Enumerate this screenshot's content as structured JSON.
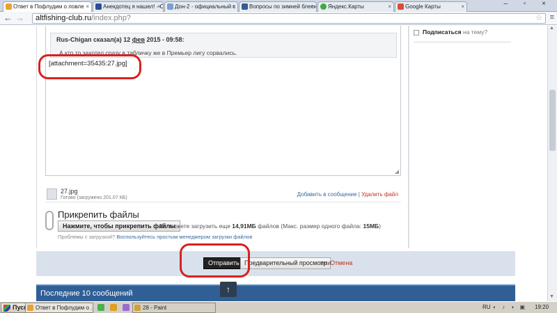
{
  "browser": {
    "tabs": [
      {
        "title": "Ответ в Пофлудим о ловле",
        "color": "#e8a232",
        "active": true
      },
      {
        "title": "Анекдотец я нашел! - Стр",
        "color": "#2b4c9b",
        "active": false
      },
      {
        "title": "Дон-2 - официальный с",
        "color": "#7aa0d4",
        "active": false
      },
      {
        "title": "Вопросы по зимней блесне",
        "color": "#335b96",
        "active": false
      },
      {
        "title": "Яндекс.Карты",
        "color": "#3eaa3e",
        "active": false
      },
      {
        "title": "Google Карты",
        "color": "#dd4b39",
        "active": false
      }
    ],
    "tab_close_glyph": "×",
    "window_controls": "–  ▫  ×",
    "back_glyph": "←",
    "forward_glyph": "→",
    "url_host": "altfishing-club.ru",
    "url_path": "/index.php?",
    "star_glyph": "☆",
    "menu_glyph": "≡"
  },
  "editor": {
    "quote_author": "Rus-Chigan сказал(а) 12 ",
    "quote_month": "фев",
    "quote_time": " 2015 - 09:58:",
    "quote_body": "А кто то захотел сразу в табличку же в Премьер лигу сорвались.",
    "body_text": "[attachment=35435:27.jpg]",
    "resize_glyph": "◢"
  },
  "attachment": {
    "file_name": "27.jpg",
    "file_status": "Готово (загружено 201.07 КБ)",
    "add_to_post": "Добавить в сообщение",
    "separator": " | ",
    "delete_file": "Удалить файл"
  },
  "attach_files": {
    "heading": "Прикрепить файлы",
    "button_label": "Нажмите, чтобы прикрепить файлы",
    "info_prefix": "Вы можете загрузить еще ",
    "info_size": "14,91МБ",
    "info_mid": " файлов (Макс. размер одного файла: ",
    "info_max": "15МБ",
    "info_end": ")",
    "help_prefix": "Проблемы с загрузкой? ",
    "help_link": "Воспользуйтесь простым менеджером загрузки файлов"
  },
  "actions": {
    "submit": "Отправить",
    "preview": "Предварительный просмотр",
    "or": "или",
    "cancel": "Отмена"
  },
  "recent": {
    "title": "Последние 10 сообщений",
    "scroll_top_glyph": "↑"
  },
  "sidebar": {
    "subscribe_bold": "Подписаться",
    "subscribe_rest": " на тему?"
  },
  "taskbar": {
    "start": "Пуск",
    "quicklaunch_colors": [
      "#3a8be0",
      "#4caf50",
      "#e0a020",
      "#9a6bd0"
    ],
    "tasks": [
      {
        "title": "Ответ в Пофлудим о ...",
        "color": "#e8a232"
      },
      {
        "title": "28 - Paint",
        "color": "#d4a032"
      }
    ],
    "language": "RU",
    "tray_glyphs": "◐ ♪ ◑ ▣",
    "clock": "19:20"
  },
  "annotations": {
    "color": "#d6211f"
  },
  "theme": {
    "recent_bar": "#2f5f95",
    "actions_bar": "#d9e2ec",
    "link": "#356a9e",
    "danger": "#b33322"
  }
}
